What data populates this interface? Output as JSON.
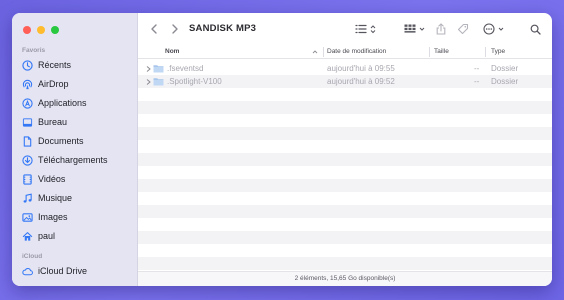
{
  "window": {
    "title": "SANDISK MP3"
  },
  "sidebar": {
    "favorites_label": "Favoris",
    "favorites": [
      {
        "label": "Récents",
        "icon": "clock-icon"
      },
      {
        "label": "AirDrop",
        "icon": "airdrop-icon"
      },
      {
        "label": "Applications",
        "icon": "applications-icon"
      },
      {
        "label": "Bureau",
        "icon": "desktop-icon"
      },
      {
        "label": "Documents",
        "icon": "document-icon"
      },
      {
        "label": "Téléchargements",
        "icon": "download-icon"
      },
      {
        "label": "Vidéos",
        "icon": "film-icon"
      },
      {
        "label": "Musique",
        "icon": "music-icon"
      },
      {
        "label": "Images",
        "icon": "photo-icon"
      },
      {
        "label": "paul",
        "icon": "home-icon"
      }
    ],
    "icloud_label": "iCloud",
    "icloud": [
      {
        "label": "iCloud Drive",
        "icon": "cloud-icon"
      }
    ]
  },
  "columns": {
    "name": "Nom",
    "modified": "Date de modification",
    "size": "Taille",
    "kind": "Type"
  },
  "files": [
    {
      "name": ".fseventsd",
      "modified": "aujourd'hui à 09:55",
      "size": "--",
      "kind": "Dossier"
    },
    {
      "name": ".Spotlight-V100",
      "modified": "aujourd'hui à 09:52",
      "size": "--",
      "kind": "Dossier"
    }
  ],
  "status": "2 éléments, 15,65 Go disponible(s)",
  "colors": {
    "accent": "#3478f6",
    "sidebar_bg": "#e4e4f3",
    "background": "#7068e8"
  }
}
